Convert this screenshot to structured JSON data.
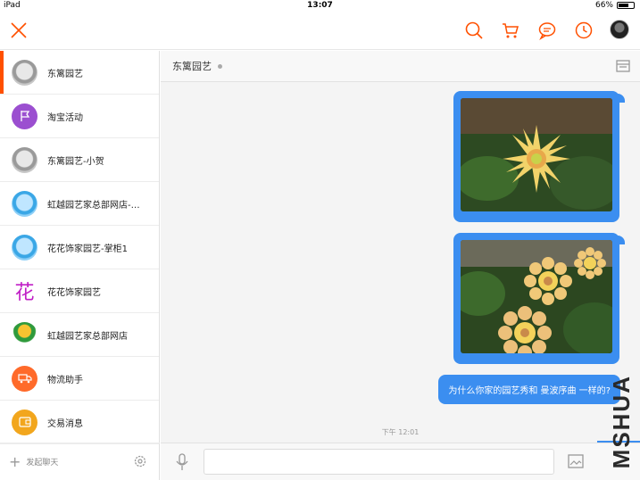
{
  "status_bar": {
    "device": "iPad",
    "time": "13:07",
    "battery": "66%",
    "battery_level": 0.66
  },
  "toolbar": {
    "icons": [
      "close-icon",
      "search-icon",
      "cart-icon",
      "message-icon",
      "history-icon",
      "avatar"
    ]
  },
  "conversations": [
    {
      "name": "东篱园艺",
      "avatar": "grey",
      "active": true
    },
    {
      "name": "淘宝活动",
      "avatar": "purple-flag"
    },
    {
      "name": "东篱园艺-小贺",
      "avatar": "grey"
    },
    {
      "name": "虹越园艺家总部网店-…",
      "avatar": "blue"
    },
    {
      "name": "花花饰家园艺-掌柜1",
      "avatar": "blue"
    },
    {
      "name": "花花饰家园艺",
      "avatar": "hua-logo",
      "logo_text": "花"
    },
    {
      "name": "虹越园艺家总部网店",
      "avatar": "store-logo"
    },
    {
      "name": "物流助手",
      "avatar": "orange-truck"
    },
    {
      "name": "交易消息",
      "avatar": "amber-wallet"
    }
  ],
  "sidebar_footer": {
    "start_chat_label": "发起聊天"
  },
  "chat": {
    "title": "东篱园艺",
    "messages": [
      {
        "type": "image",
        "subject": "dahlia-flower-photo"
      },
      {
        "type": "image",
        "subject": "dahlia-flowers-photo"
      },
      {
        "type": "text",
        "text": "为什么你家的园艺秀和 曼波序曲 一样的?"
      }
    ],
    "timestamp": "下午 12:01"
  },
  "colors": {
    "accent": "#ff5000",
    "bubble": "#3b8ef0"
  },
  "watermark": "MSHUA"
}
